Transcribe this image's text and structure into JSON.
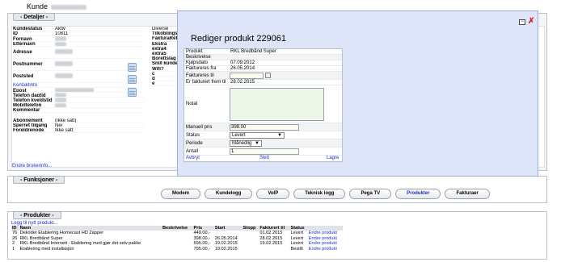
{
  "page": {
    "title": "Kunde"
  },
  "detaljer": {
    "heading": "- Detaljer -",
    "rows": [
      {
        "k": "Kundestatus",
        "v": "Aktiv"
      },
      {
        "k": "ID",
        "v": "10811"
      },
      {
        "k": "Fornavn",
        "v": ""
      },
      {
        "k": "Etternavn",
        "v": ""
      },
      {
        "k": "Adresse",
        "v": ""
      },
      {
        "k": "Postnummer",
        "v": ""
      },
      {
        "k": "Poststed",
        "v": ""
      },
      {
        "k": "Kontaktinfo",
        "v": ""
      },
      {
        "k": "Epost",
        "v": ""
      },
      {
        "k": "Telefon dagtid",
        "v": ""
      },
      {
        "k": "Telefon kveldstid",
        "v": ""
      },
      {
        "k": "Mobiltelefon",
        "v": ""
      },
      {
        "k": "Kommentar",
        "v": ""
      },
      {
        "k": "Abonnement",
        "v": "(Ikke satt)"
      },
      {
        "k": "Sperret tilgang",
        "v": "Nei"
      },
      {
        "k": "Foreldrenode",
        "v": "Ikke satt"
      }
    ],
    "col2": [
      "Diverse",
      "Tilkoblingsda",
      "FakturaRef.",
      "Ekstra",
      "extra4",
      "extra5",
      "Borettslag",
      "Snill kunde",
      "Wifi?",
      "c",
      "d",
      "e"
    ],
    "endre_link": "Endre brukerinfo..."
  },
  "funksjoner": {
    "heading": "- Funksjoner -",
    "buttons": [
      "Modem",
      "Kundelogg",
      "VoIP",
      "Teknisk logg",
      "Pega TV",
      "Produkter",
      "Fakturaer"
    ]
  },
  "produkter": {
    "heading": "- Produkter -",
    "add_link": "Legg til nytt produkt...",
    "columns": [
      "ID",
      "Navn",
      "Beskrivelse",
      "Pris",
      "Start",
      "Stopp",
      "Fakturert til",
      "Status",
      ""
    ],
    "rows": [
      {
        "id": "76",
        "navn": "Dekoder Etablering Homecast HD Zapper",
        "besk": "",
        "pris": "449.00,-",
        "start": "",
        "stopp": "",
        "fakt": "01.02.2015",
        "status": "Levert",
        "action": "Endre produkt"
      },
      {
        "id": "26",
        "navn": "RKL Bredbånd Super",
        "besk": "",
        "pris": "398.00,-",
        "start": "26.05.2014",
        "stopp": "",
        "fakt": "28.02.2015",
        "status": "Levert",
        "action": "Endre produkt"
      },
      {
        "id": "2",
        "navn": "RKL Bredbånd Internett - Etablering med gjør det selv pakke",
        "besk": "",
        "pris": "595.00,-",
        "start": "19.02.2015",
        "stopp": "",
        "fakt": "19.02.2015",
        "status": "Levert",
        "action": "Endre produkt"
      },
      {
        "id": "1",
        "navn": "Etablering med installasjon",
        "besk": "",
        "pris": "795.00,-",
        "start": "19.02.2015",
        "stopp": "",
        "fakt": "",
        "status": "Bestilt",
        "action": "Endre produkt"
      }
    ]
  },
  "modal": {
    "title": "Rediger produkt 229061",
    "min_icon": "−",
    "close_icon": "✗",
    "fields": {
      "produkt_l": "Produkt",
      "produkt_v": "RKL Bredbånd Super",
      "beskrivelse_l": "Beskrivelse",
      "kjopsdato_l": "Kjøpsdato",
      "kjopsdato_v": "07.09.2012",
      "faktureres_fra_l": "Faktureres fra",
      "faktureres_fra_v": "26.05.2014",
      "faktureres_til_l": "Faktureres til",
      "faktureres_til_v": "",
      "fakturert_l": "Er fakturert frem til",
      "fakturert_v": "28.02.2015",
      "notat_l": "Notat",
      "manuell_l": "Manuell pris",
      "manuell_v": "398.00",
      "status_l": "Status",
      "status_v": "Levert",
      "periode_l": "Periode",
      "periode_v": "Månedlig",
      "antall_l": "Antall",
      "antall_v": "1"
    },
    "actions": {
      "abryt": "Avbryt",
      "slett": "Slett",
      "lagre": "Lagre"
    }
  }
}
